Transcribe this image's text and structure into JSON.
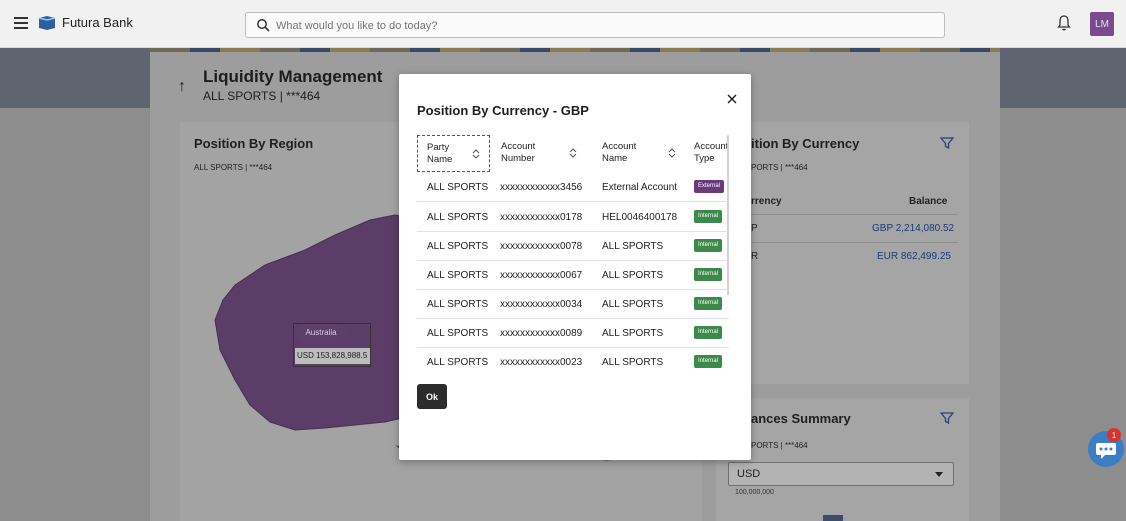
{
  "topbar": {
    "brand": "Futura Bank",
    "search_placeholder": "What would you like to do today?",
    "avatar_initials": "LM"
  },
  "page": {
    "title": "Liquidity Management",
    "subtitle": "ALL SPORTS | ***464"
  },
  "region_card": {
    "title": "Position By Region",
    "subtitle": "ALL SPORTS | ***464",
    "map_label": "Australia",
    "map_value": "USD 153,828,988.5"
  },
  "currency_card": {
    "title": "ition By Currency",
    "subtitle": "PORTS | ***464",
    "col_currency": "rrency",
    "col_balance": "Balance",
    "rows": [
      {
        "currency": "P",
        "balance": "GBP 2,214,080.52"
      },
      {
        "currency": "R",
        "balance": "EUR 862,499.25"
      }
    ]
  },
  "balances_card": {
    "title": "ances Summary",
    "subtitle": "PORTS | ***464",
    "select_value": "USD",
    "axis_label": "100,000,000"
  },
  "chat": {
    "badge": "1"
  },
  "modal": {
    "title": "Position By Currency - GBP",
    "headers": {
      "party_name": "Party Name",
      "account_number": "Account Number",
      "account_name": "Account Name",
      "account_type": "Account Type"
    },
    "rows": [
      {
        "party": "ALL SPORTS",
        "account": "xxxxxxxxxxxx3456",
        "name": "External Account",
        "type": "External"
      },
      {
        "party": "ALL SPORTS",
        "account": "xxxxxxxxxxxx0178",
        "name": "HEL0046400178",
        "type": "Internal"
      },
      {
        "party": "ALL SPORTS",
        "account": "xxxxxxxxxxxx0078",
        "name": "ALL SPORTS",
        "type": "Internal"
      },
      {
        "party": "ALL SPORTS",
        "account": "xxxxxxxxxxxx0067",
        "name": "ALL SPORTS",
        "type": "Internal"
      },
      {
        "party": "ALL SPORTS",
        "account": "xxxxxxxxxxxx0034",
        "name": "ALL SPORTS",
        "type": "Internal"
      },
      {
        "party": "ALL SPORTS",
        "account": "xxxxxxxxxxxx0089",
        "name": "ALL SPORTS",
        "type": "Internal"
      },
      {
        "party": "ALL SPORTS",
        "account": "xxxxxxxxxxxx0023",
        "name": "ALL SPORTS",
        "type": "Internal"
      }
    ],
    "ok_label": "Ok"
  }
}
